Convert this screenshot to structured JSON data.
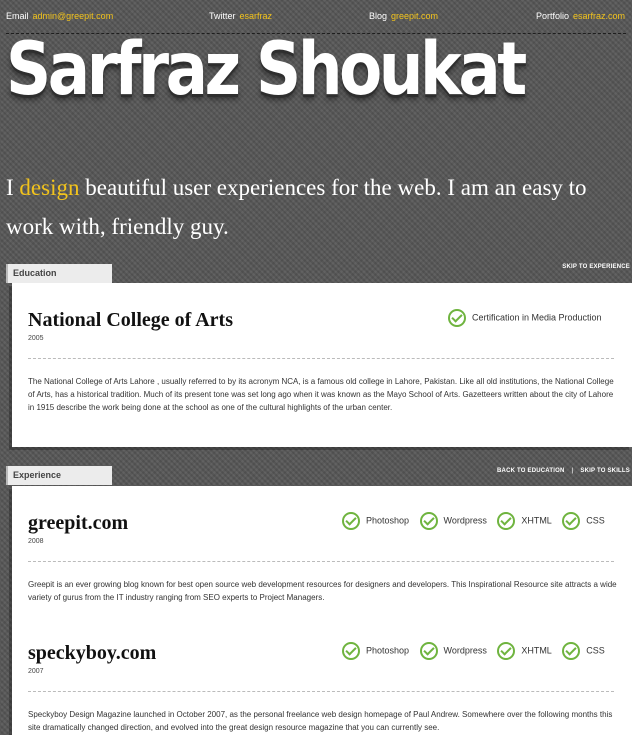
{
  "header": {
    "email_label": "Email",
    "email_value": "admin@greepit.com",
    "twitter_label": "Twitter",
    "twitter_value": "esarfraz",
    "blog_label": "Blog",
    "blog_value": "greepit.com",
    "portfolio_label": "Portfolio",
    "portfolio_value": "esarfraz.com"
  },
  "name": "Sarfraz Shoukat",
  "tagline": {
    "pre": "I ",
    "highlight": "design",
    "post": " beautiful user experiences for the web. I am an easy to work with, friendly guy."
  },
  "education": {
    "tab": "Education",
    "skip_link": "SKIP TO EXPERIENCE",
    "title": "National College of Arts",
    "year": "2005",
    "certification": "Certification in Media Production",
    "description": "The National College of Arts Lahore , usually referred to by its acronym NCA, is a famous old college in Lahore, Pakistan. Like all old institutions, the National College of Arts, has a historical tradition. Much of its present tone was set long ago when it was known as the Mayo School of Arts. Gazetteers written about the city of Lahore in 1915 describe the work being done at the school as one of the cultural highlights of the urban center."
  },
  "experience": {
    "tab": "Experience",
    "back_link": "BACK TO EDUCATION",
    "skip_link": "SKIP TO SKILLS",
    "items": [
      {
        "title": "greepit.com",
        "year": "2008",
        "skills": [
          "Photoshop",
          "Wordpress",
          "XHTML",
          "CSS"
        ],
        "description": "Greepit is an ever growing blog known for best open source web development resources for designers and developers. This Inspirational Resource site attracts a wide variety of gurus from the IT industry ranging from SEO experts to Project Managers."
      },
      {
        "title": "speckyboy.com",
        "year": "2007",
        "skills": [
          "Photoshop",
          "Wordpress",
          "XHTML",
          "CSS"
        ],
        "description": "Speckyboy Design Magazine launched in October 2007, as the personal freelance web design homepage of Paul Andrew. Somewhere over the following months this site dramatically changed direction, and evolved into the great design resource magazine that you can currently see."
      }
    ]
  },
  "colors": {
    "accent": "#f2c31c",
    "check": "#6fb43f",
    "background": "#565656"
  },
  "icons": {
    "skill_badge": "check-circle-icon"
  }
}
